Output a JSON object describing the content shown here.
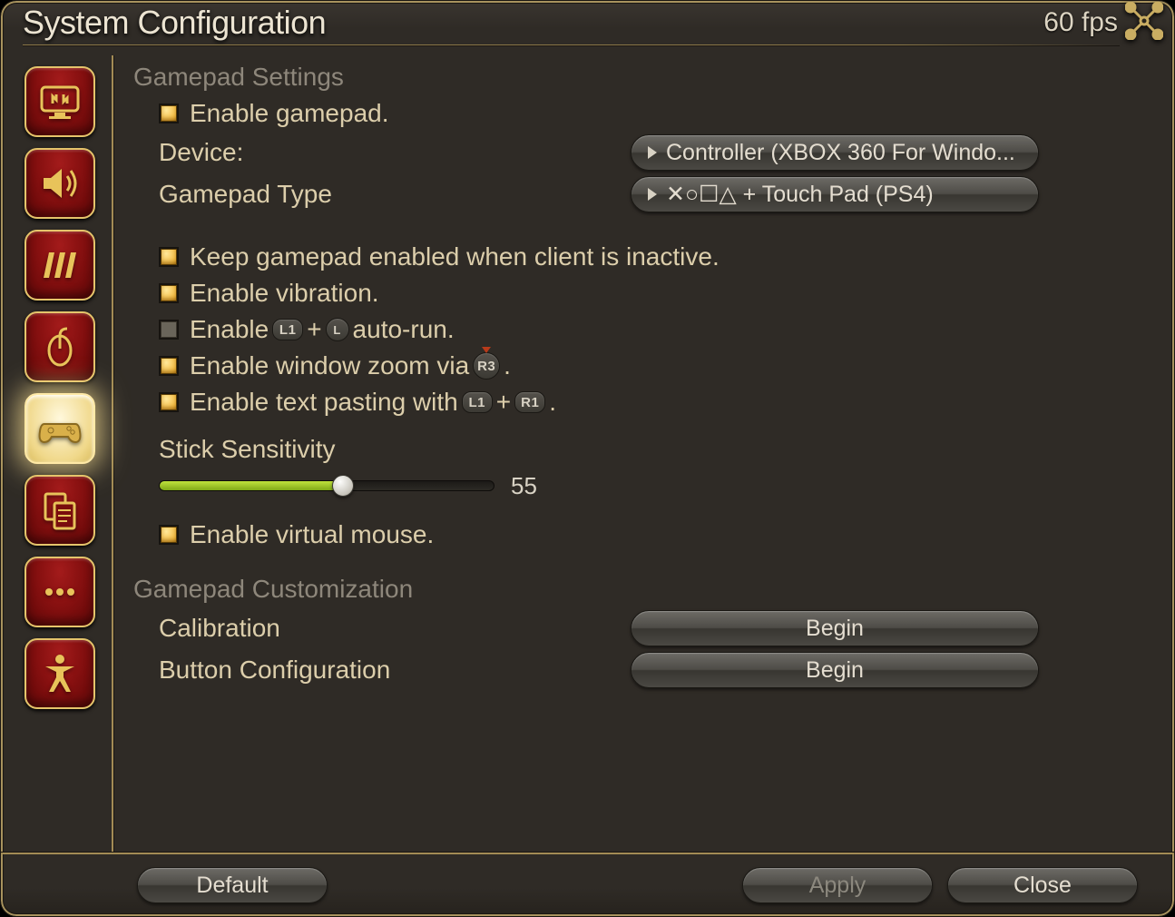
{
  "window": {
    "title": "System Configuration",
    "fps": "60 fps"
  },
  "rail": {
    "items": [
      {
        "name": "display",
        "active": false
      },
      {
        "name": "sound",
        "active": false
      },
      {
        "name": "graphics",
        "active": false
      },
      {
        "name": "mouse",
        "active": false
      },
      {
        "name": "gamepad",
        "active": true
      },
      {
        "name": "clipboard",
        "active": false
      },
      {
        "name": "other",
        "active": false
      },
      {
        "name": "accessibility",
        "active": false
      }
    ]
  },
  "main": {
    "section1_heading": "Gamepad Settings",
    "enable_gamepad": {
      "checked": true,
      "label": "Enable gamepad."
    },
    "device": {
      "label": "Device:",
      "value": "Controller (XBOX 360 For Windo..."
    },
    "gamepad_type": {
      "label": "Gamepad Type",
      "value": "✕○☐△ + Touch Pad (PS4)"
    },
    "keep_enabled": {
      "checked": true,
      "label": "Keep gamepad enabled when client is inactive."
    },
    "vibration": {
      "checked": true,
      "label": "Enable vibration."
    },
    "autorun": {
      "checked": false,
      "prefix": "Enable ",
      "key1": "L1",
      "plus": "+",
      "key2": "L",
      "suffix": " auto-run."
    },
    "window_zoom": {
      "checked": true,
      "prefix": "Enable window zoom via ",
      "key": "R3",
      "suffix": " ."
    },
    "text_paste": {
      "checked": true,
      "prefix": "Enable text pasting with ",
      "key1": "L1",
      "plus": " + ",
      "key2": "R1",
      "suffix": " ."
    },
    "stick_sensitivity": {
      "label": "Stick Sensitivity",
      "value": "55",
      "percent": 55
    },
    "virtual_mouse": {
      "checked": true,
      "label": "Enable virtual mouse."
    },
    "section2_heading": "Gamepad Customization",
    "calibration": {
      "label": "Calibration",
      "button": "Begin"
    },
    "button_config": {
      "label": "Button Configuration",
      "button": "Begin"
    }
  },
  "footer": {
    "default": "Default",
    "apply": "Apply",
    "close": "Close"
  }
}
